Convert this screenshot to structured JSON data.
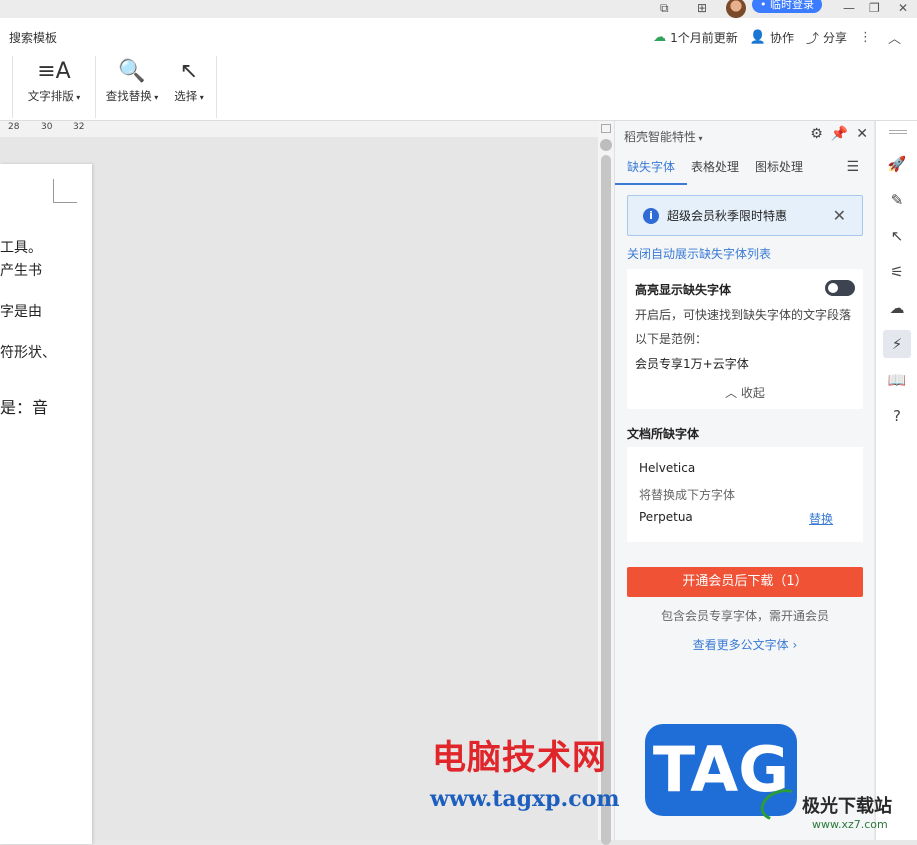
{
  "titlebar": {
    "login_label": "• 临时登录",
    "minimize": "—",
    "restore": "❐",
    "close": "✕"
  },
  "ribbon": {
    "search_template": "搜索模板",
    "update_status": "1个月前更新",
    "collaborate": "协作",
    "share": "分享",
    "tools": [
      {
        "label": "文字排版",
        "icon": "text-layout-icon"
      },
      {
        "label": "查找替换",
        "icon": "search-icon"
      },
      {
        "label": "选择",
        "icon": "cursor-select-icon"
      }
    ]
  },
  "ruler": {
    "ticks": [
      "28",
      "30",
      "32"
    ]
  },
  "document": {
    "lines": [
      "工具。",
      "产生书",
      "字是由",
      "符形状、",
      "是：音"
    ]
  },
  "panel": {
    "title": "稻壳智能特性",
    "tabs": [
      "缺失字体",
      "表格处理",
      "图标处理"
    ],
    "active_tab": "缺失字体",
    "notice": "超级会员秋季限时特惠",
    "close_auto_show_link": "关闭自动展示缺失字体列表",
    "highlight": {
      "title": "高亮显示缺失字体",
      "toggle_on": false,
      "desc": "开启后，可快速找到缺失字体的文字段落",
      "example_label": "以下是范例：",
      "example_text": "会员专享1万+云字体",
      "collapse": "收起"
    },
    "missing_fonts": {
      "title": "文档所缺字体",
      "font": "Helvetica",
      "replace_hint": "将替换成下方字体",
      "replacement": "Perpetua",
      "replace_action": "替换"
    },
    "cta": "开通会员后下载（1）",
    "cta_sub": "包含会员专享字体，需开通会员",
    "more_link": "查看更多公文字体"
  },
  "rail": {
    "icons": [
      "rocket-icon",
      "pen-icon",
      "cursor-icon",
      "sliders-icon",
      "cloud-doc-icon",
      "smart-feature-icon",
      "book-search-icon",
      "help-icon"
    ]
  },
  "watermark": {
    "cn": "电脑技术网",
    "url": "www.tagxp.com",
    "logo": "TAG",
    "site_name": "极光下载站",
    "site_url": "www.xz7.com"
  },
  "colors": {
    "accent": "#3a7bd5",
    "cta": "#f05236",
    "login": "#3a7bff"
  }
}
